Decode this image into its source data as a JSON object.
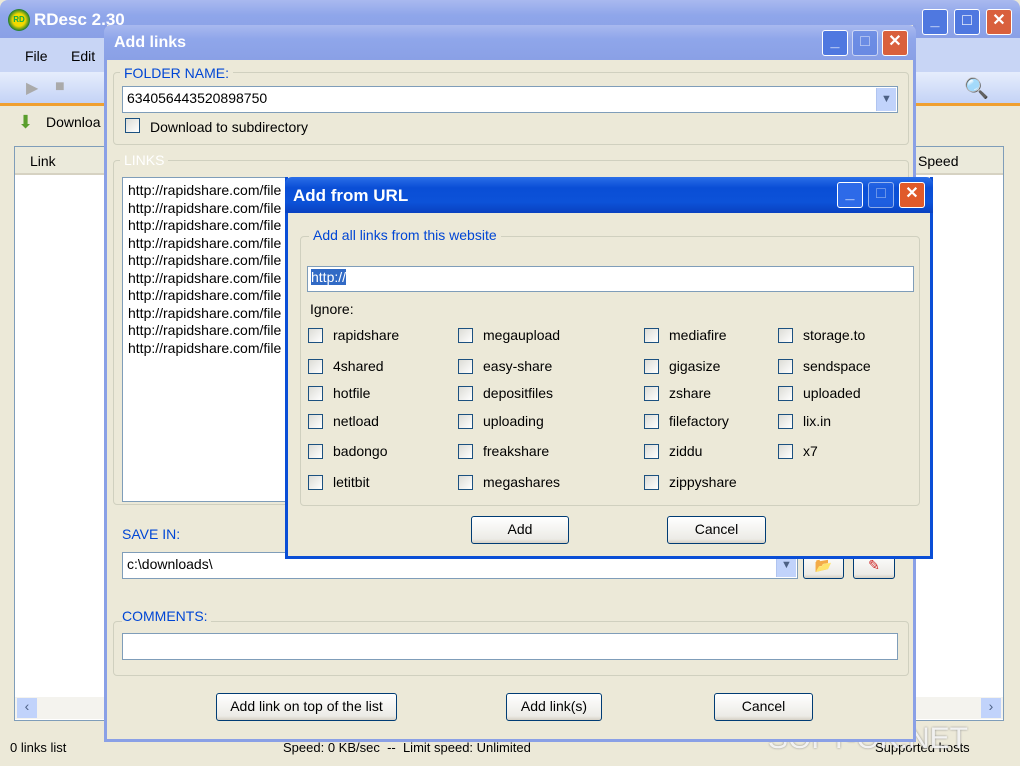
{
  "main": {
    "title": "RDesc 2.30",
    "menu": [
      "File",
      "Edit"
    ],
    "tab": "Downloa",
    "columns": {
      "link": "Link",
      "speed": "Speed"
    },
    "status": {
      "count": "0 links list",
      "speed": "Speed: 0 KB/sec  --  Limit speed: Unlimited",
      "supported": "Supported hosts"
    }
  },
  "add_links": {
    "title": "Add links",
    "folder_label": "FOLDER NAME:",
    "folder_value": "634056443520898750",
    "subdir_label": "Download to subdirectory",
    "subdir_checked": false,
    "links_label": "LINKS",
    "links": [
      "http://rapidshare.com/file",
      "http://rapidshare.com/file",
      "http://rapidshare.com/file",
      "http://rapidshare.com/file",
      "http://rapidshare.com/file",
      "http://rapidshare.com/file",
      "http://rapidshare.com/file",
      "http://rapidshare.com/file",
      "http://rapidshare.com/file",
      "http://rapidshare.com/file"
    ],
    "save_label": "SAVE IN:",
    "save_value": "c:\\downloads\\",
    "comments_label": "COMMENTS:",
    "comments_value": "",
    "buttons": {
      "top": "Add link on top of the list",
      "add": "Add link(s)",
      "cancel": "Cancel"
    }
  },
  "add_url": {
    "title": "Add from URL",
    "group_label": "Add all links from this website",
    "url_value": "http://",
    "ignore_label": "Ignore:",
    "hosts": [
      [
        "rapidshare",
        "4shared",
        "hotfile",
        "netload",
        "badongo",
        "letitbit"
      ],
      [
        "megaupload",
        "easy-share",
        "depositfiles",
        "uploading",
        "freakshare",
        "megashares"
      ],
      [
        "mediafire",
        "gigasize",
        "zshare",
        "filefactory",
        "ziddu",
        "zippyshare"
      ],
      [
        "storage.to",
        "sendspace",
        "uploaded",
        "lix.in",
        "x7"
      ]
    ],
    "buttons": {
      "add": "Add",
      "cancel": "Cancel"
    }
  },
  "watermark": "SOFT-OK.NET"
}
